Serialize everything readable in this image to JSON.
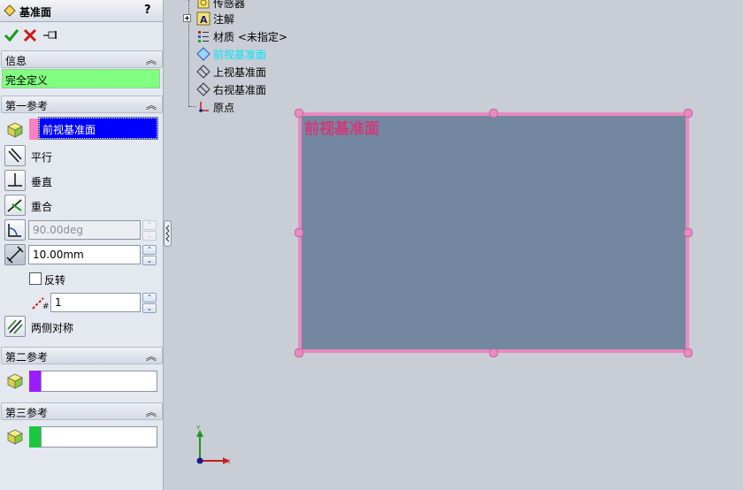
{
  "property_manager": {
    "title": "基准面",
    "help": "?",
    "actions": [
      "ok-check-icon",
      "cancel-x-icon",
      "pushpin-icon"
    ],
    "info": {
      "header": "信息",
      "status": "完全定义"
    },
    "first_ref": {
      "header": "第一参考",
      "selection": "前视基准面",
      "swatch_color": "#ff80c0",
      "options": {
        "parallel": "平行",
        "perpendicular": "垂直",
        "coincident": "重合"
      },
      "angle_value": "90.00deg",
      "distance_value": "10.00mm",
      "flip_label": "反转",
      "count_value": "1",
      "mid_plane_label": "两侧对称"
    },
    "second_ref": {
      "header": "第二参考",
      "selection": "",
      "swatch_color": "#9b1cff"
    },
    "third_ref": {
      "header": "第三参考",
      "selection": "",
      "swatch_color": "#19c83c"
    }
  },
  "feature_tree": {
    "items": [
      {
        "label": "传感器",
        "icon": "sensor-icon"
      },
      {
        "label": "注解",
        "icon": "annotation-icon",
        "expandable": true
      },
      {
        "label": "材质 <未指定>",
        "icon": "material-icon"
      },
      {
        "label": "前视基准面",
        "icon": "plane-icon",
        "selected": true
      },
      {
        "label": "上视基准面",
        "icon": "plane-icon"
      },
      {
        "label": "右视基准面",
        "icon": "plane-icon"
      },
      {
        "label": "原点",
        "icon": "origin-icon"
      }
    ]
  },
  "viewport": {
    "plane_label": "前视基准面",
    "plane_color": "#7388a0",
    "plane_border_color": "#e98ac0",
    "triad": {
      "x": "X",
      "y": "Y"
    }
  }
}
